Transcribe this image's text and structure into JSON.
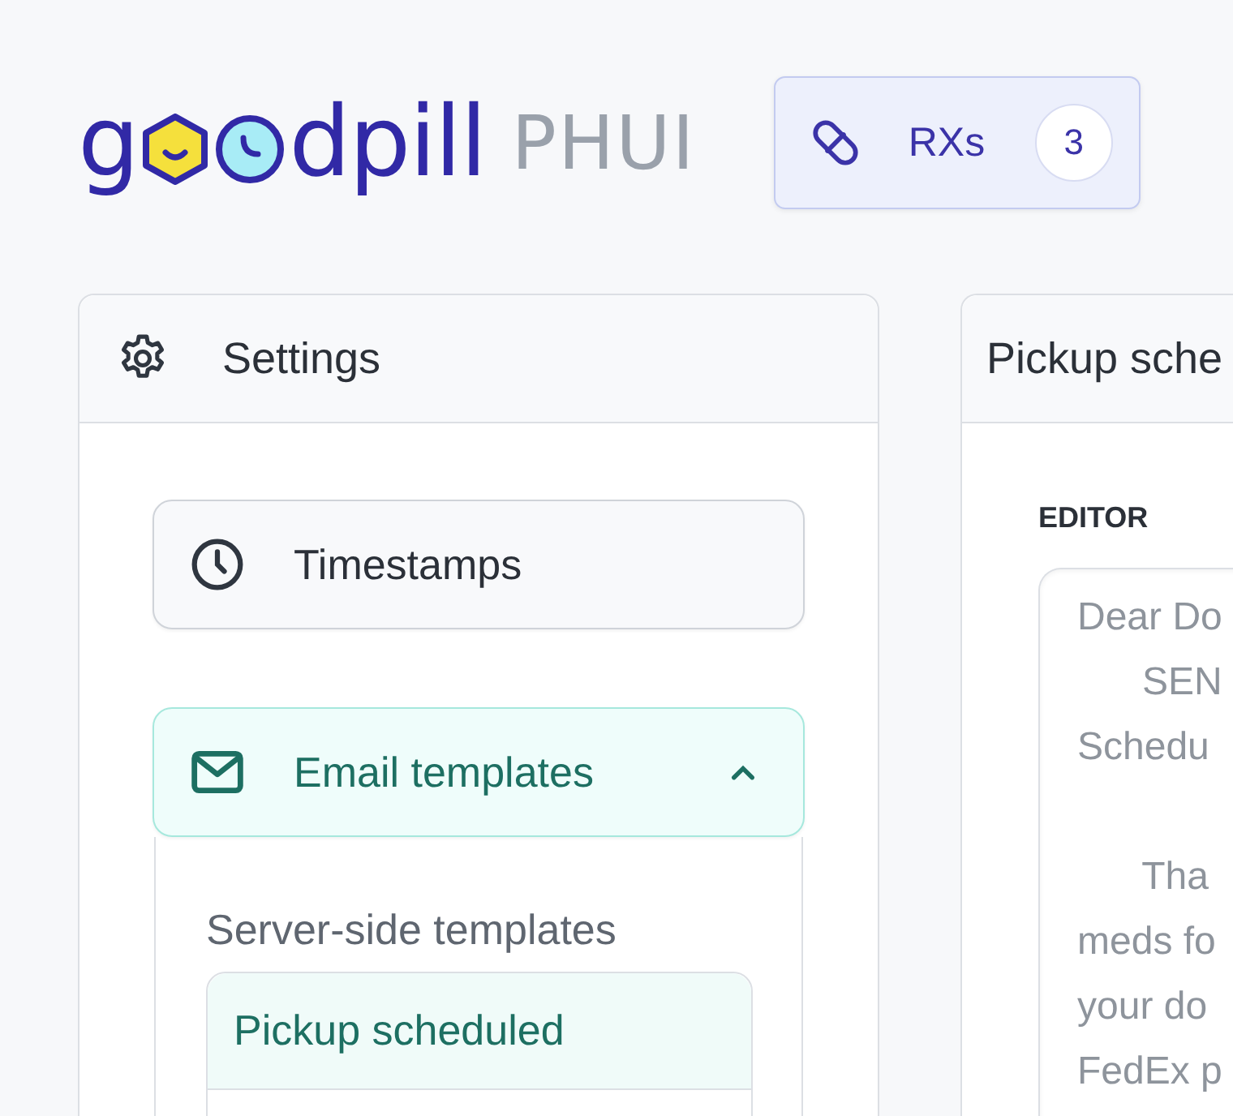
{
  "logo": {
    "lead": "g",
    "tail": "dpill",
    "product": "PHUI"
  },
  "rx_button": {
    "label": "RXs",
    "count": "3"
  },
  "settings": {
    "title": "Settings",
    "sections": [
      {
        "kind": "link",
        "label": "Timestamps"
      },
      {
        "kind": "accordion",
        "label": "Email templates",
        "expanded": true,
        "group_label": "Server-side templates",
        "templates": [
          {
            "label": "Pickup scheduled",
            "selected": true
          }
        ]
      }
    ]
  },
  "editor_panel": {
    "title": "Pickup sche",
    "editor_label": "EDITOR",
    "paragraphs": [
      [
        "Dear Do",
        "      SEN",
        "Schedu"
      ],
      [
        "      Tha",
        "meds fo",
        "your do",
        "FedEx p"
      ]
    ]
  }
}
